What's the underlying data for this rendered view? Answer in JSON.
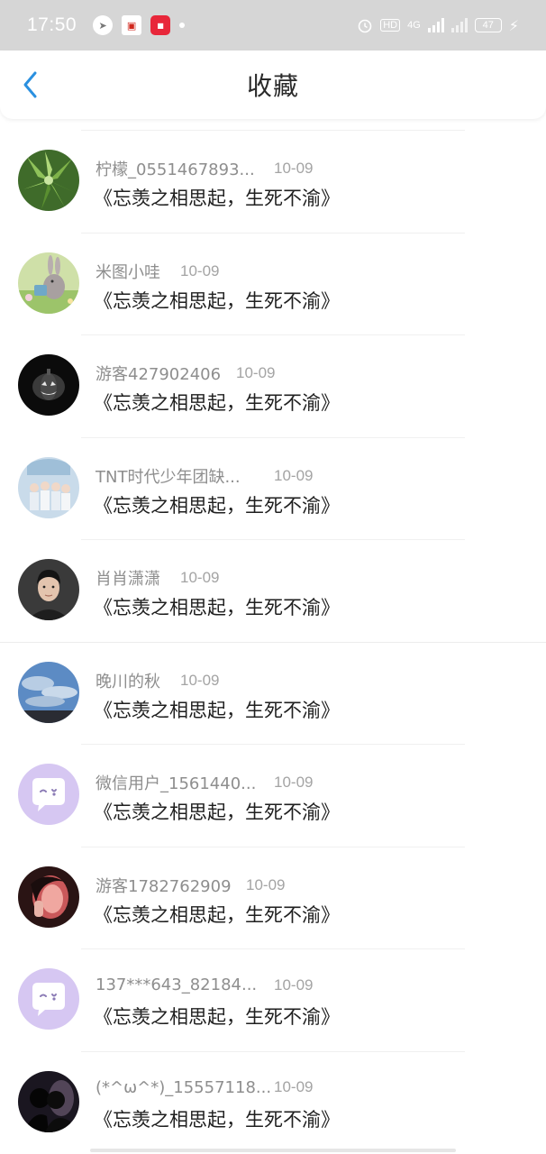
{
  "status_bar": {
    "time": "17:50",
    "hd_label": "HD",
    "network": "4G",
    "battery": "47"
  },
  "header": {
    "title": "收藏",
    "accent_color": "#2a90e0"
  },
  "items": [
    {
      "username": "柠檬_0551467893...",
      "date": "10-09",
      "content": "《忘羡之相思起，生死不渝》",
      "avatar": "succulent-plant"
    },
    {
      "username": "米图小哇",
      "date": "10-09",
      "content": "《忘羡之相思起，生死不渝》",
      "avatar": "bunny-on-grass"
    },
    {
      "username": "游客427902406",
      "date": "10-09",
      "content": "《忘羡之相思起，生死不渝》",
      "avatar": "dark-pumpkin"
    },
    {
      "username": "TNT时代少年团缺...",
      "date": "10-09",
      "content": "《忘羡之相思起，生死不渝》",
      "avatar": "group-photo"
    },
    {
      "username": "肖肖潇潇",
      "date": "10-09",
      "content": "《忘羡之相思起，生死不渝》",
      "avatar": "man-portrait"
    },
    {
      "username": "晚川的秋",
      "date": "10-09",
      "content": "《忘羡之相思起，生死不渝》",
      "avatar": "sky-clouds"
    },
    {
      "username": "微信用户_1561440...",
      "date": "10-09",
      "content": "《忘羡之相思起，生死不渝》",
      "avatar": "default-chat-bubble"
    },
    {
      "username": "游客1782762909",
      "date": "10-09",
      "content": "《忘羡之相思起，生死不渝》",
      "avatar": "girl-pink-light"
    },
    {
      "username": "137***643_82184...",
      "date": "10-09",
      "content": "《忘羡之相思起，生死不渝》",
      "avatar": "default-chat-bubble"
    },
    {
      "username": "(*^ω^*)_15557118...",
      "date": "10-09",
      "content": "《忘羡之相思起，生死不渝》",
      "avatar": "couple-silhouette"
    }
  ]
}
